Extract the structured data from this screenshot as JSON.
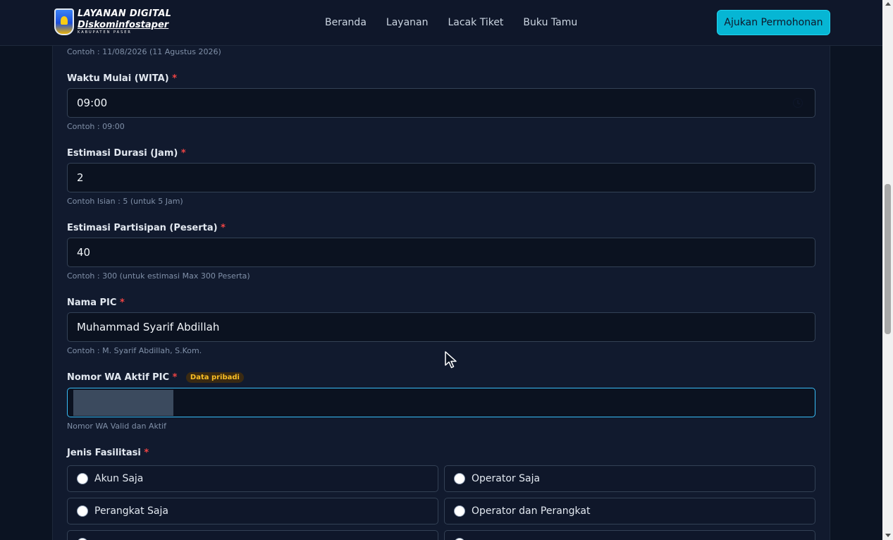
{
  "nav": {
    "logo_line1": "LAYANAN DIGITAL",
    "logo_line2": "Diskominfostaper",
    "logo_line3": "KABUPATEN PASER",
    "links": [
      "Beranda",
      "Layanan",
      "Lacak Tiket",
      "Buku Tamu"
    ],
    "cta_label": "Ajukan Permohonan"
  },
  "form": {
    "date_hint": "Contoh : 11/08/2026 (11 Agustus 2026)",
    "start_time": {
      "label": "Waktu Mulai (WITA)",
      "required": "*",
      "value": "09:00",
      "hint": "Contoh : 09:00"
    },
    "duration": {
      "label": "Estimasi Durasi (Jam)",
      "required": "*",
      "value": "2",
      "hint": "Contoh Isian : 5 (untuk 5 Jam)"
    },
    "participants": {
      "label": "Estimasi Partisipan (Peserta)",
      "required": "*",
      "value": "40",
      "hint": "Contoh : 300 (untuk estimasi Max 300 Peserta)"
    },
    "pic_name": {
      "label": "Nama PIC",
      "required": "*",
      "value": "Muhammad Syarif Abdillah",
      "hint": "Contoh : M. Syarif Abdillah, S.Kom."
    },
    "pic_wa": {
      "label": "Nomor WA Aktif PIC",
      "required": "*",
      "badge": "Data pribadi",
      "value": "",
      "hint": "Nomor WA Valid dan Aktif"
    },
    "facility": {
      "label": "Jenis Fasilitasi",
      "required": "*",
      "options": [
        "Akun Saja",
        "Operator Saja",
        "Perangkat Saja",
        "Operator dan Perangkat"
      ]
    }
  },
  "colors": {
    "accent": "#06b6d4",
    "required": "#ef4444",
    "badge": "#fbbf24"
  }
}
